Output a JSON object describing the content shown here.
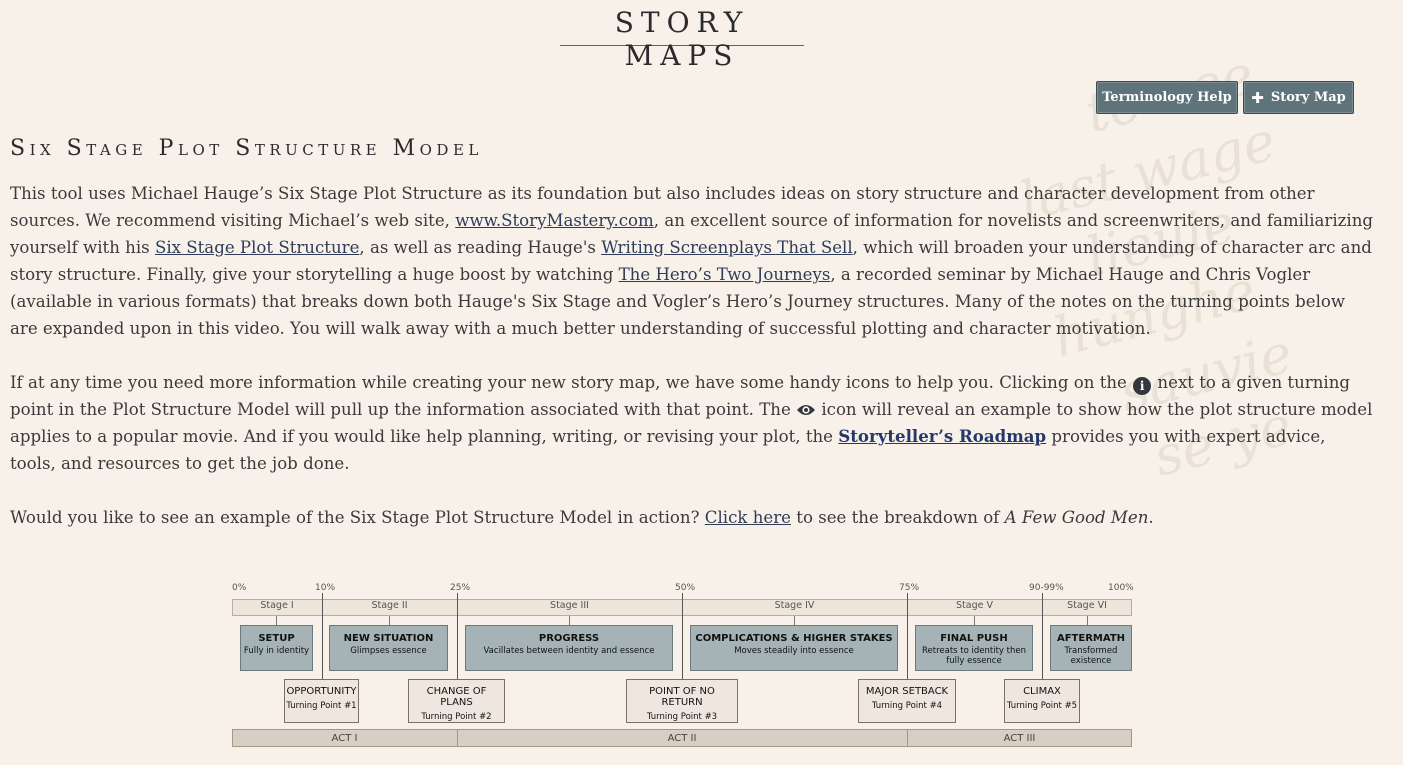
{
  "site_title": "STORY MAPS",
  "buttons": {
    "terminology_help": "Terminology Help",
    "story_map": "Story Map"
  },
  "model_title": "Six Stage Plot Structure Model",
  "intro": {
    "p1_a": "This tool uses Michael Hauge’s Six Stage Plot Structure as its foundation but also includes ideas on story structure and character development from other sources. We recommend visiting Michael’s web site, ",
    "link_storymastery": "www.StoryMastery.com",
    "p1_b": ", an excellent source of information for novelists and screenwriters, and familiarizing yourself with his ",
    "link_six_stage": "Six Stage Plot Structure",
    "p1_c": ", as well as reading Hauge's ",
    "link_writing": "Writing Screenplays That Sell",
    "p1_d": ", which will broaden your understanding of character arc and story structure. Finally, give your storytelling a huge boost by watching ",
    "link_heros": "The Hero’s Two Journeys",
    "p1_e": ", a recorded seminar by Michael Hauge and Chris Vogler (available in various formats) that breaks down both Hauge's Six Stage and Vogler’s Hero’s Journey structures. Many of the notes on the turning points below are expanded upon in this video. You will walk away with a much better understanding of successful plotting and character motivation.",
    "p2_a": "If at any time you need more information while creating your new story map, we have some handy icons to help you. Clicking on the ",
    "p2_b": " next to a given turning point in the Plot Structure Model will pull up the information associated with that point. The ",
    "p2_c": " icon will reveal an example to show how the plot structure model applies to a popular movie. And if you would like help planning, writing, or revising your plot, the ",
    "link_roadmap": "Storyteller’s Roadmap",
    "p2_d": " provides you with expert advice, tools, and resources to get the job done.",
    "p3_a": "Would you like to see an example of the Six Stage Plot Structure Model in action? ",
    "link_click": "Click here",
    "p3_b": " to see the breakdown of ",
    "p3_movie": "A Few Good Men",
    "p3_c": "."
  },
  "diagram": {
    "percents": [
      "0%",
      "10%",
      "25%",
      "50%",
      "75%",
      "90-99%",
      "100%"
    ],
    "stages": [
      "Stage I",
      "Stage II",
      "Stage III",
      "Stage IV",
      "Stage V",
      "Stage VI"
    ],
    "stage_boxes": [
      {
        "title": "SETUP",
        "sub": "Fully in identity"
      },
      {
        "title": "NEW SITUATION",
        "sub": "Glimpses essence"
      },
      {
        "title": "PROGRESS",
        "sub": "Vacillates between identity and essence"
      },
      {
        "title": "COMPLICATIONS & HIGHER STAKES",
        "sub": "Moves steadily into essence"
      },
      {
        "title": "FINAL PUSH",
        "sub": "Retreats to identity then fully essence"
      },
      {
        "title": "AFTERMATH",
        "sub": "Transformed existence"
      }
    ],
    "turning_points": [
      {
        "title": "OPPORTUNITY",
        "sub": "Turning Point #1"
      },
      {
        "title": "CHANGE OF PLANS",
        "sub": "Turning Point #2"
      },
      {
        "title": "POINT OF NO RETURN",
        "sub": "Turning Point #3"
      },
      {
        "title": "MAJOR SETBACK",
        "sub": "Turning Point #4"
      },
      {
        "title": "CLIMAX",
        "sub": "Turning Point #5"
      }
    ],
    "acts": [
      "ACT I",
      "ACT II",
      "ACT III"
    ]
  }
}
